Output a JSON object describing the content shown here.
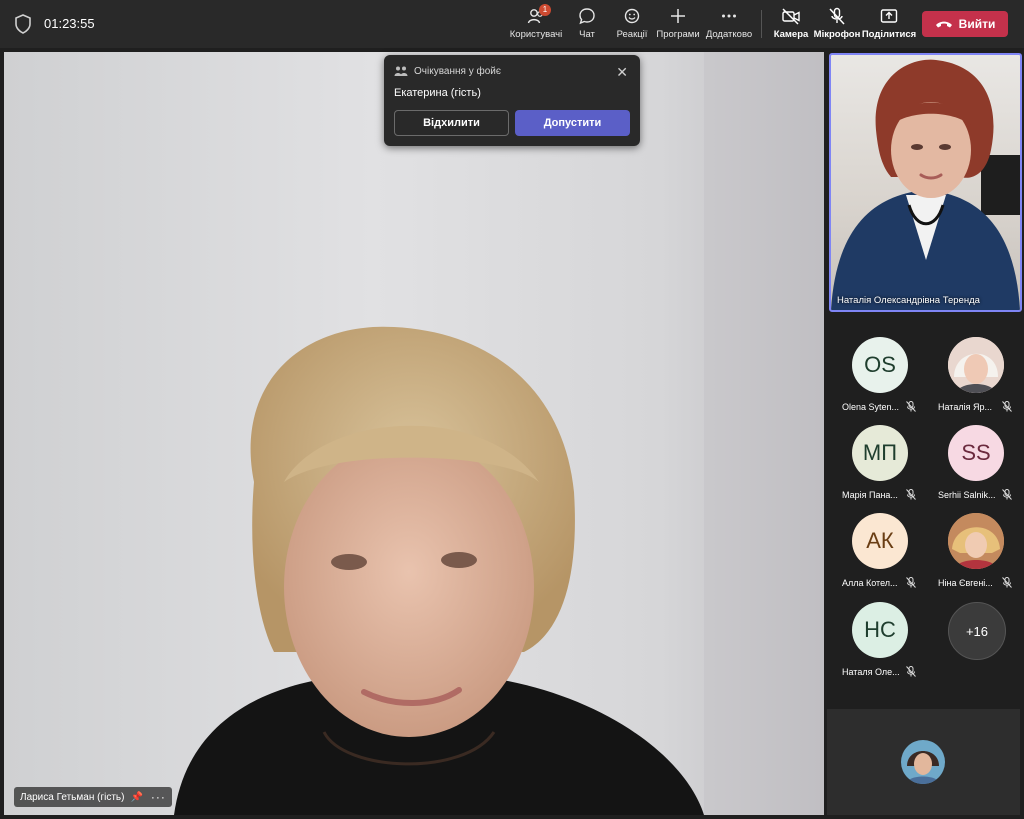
{
  "topbar": {
    "timer": "01:23:55",
    "participants_label": "Користувачі",
    "participants_badge": "1",
    "chat_label": "Чат",
    "reactions_label": "Реакції",
    "apps_label": "Програми",
    "more_label": "Додатково",
    "camera_label": "Камера",
    "mic_label": "Мікрофон",
    "share_label": "Поділитися",
    "leave_label": "Вийти",
    "leave_color": "#c4314b"
  },
  "lobby": {
    "title": "Очікування у фойє",
    "guest_name": "Екатерина (гість)",
    "deny_label": "Відхилити",
    "admit_label": "Допустити",
    "admit_color": "#5b5fc7"
  },
  "main_video": {
    "name": "Лариса Гетьман (гість)"
  },
  "speaker": {
    "name": "Наталія Олександрівна Теренда",
    "border_color": "#7f85f5"
  },
  "gallery": {
    "tiles": [
      {
        "initials": "OS",
        "name": "Olena Syten...",
        "color": "#e8f2ec"
      },
      {
        "initials": "",
        "name": "Наталія Яр...",
        "color": "#e9d7cf"
      },
      {
        "initials": "МП",
        "name": "Марія Пана...",
        "color": "#e6ead8"
      },
      {
        "initials": "SS",
        "name": "Serhii Salnik...",
        "color": "#f7d9e3"
      },
      {
        "initials": "АК",
        "name": "Алла Котел...",
        "color": "#fbe7d2"
      },
      {
        "initials": "",
        "name": "Ніна Євгені...",
        "color": "#d9a57a"
      },
      {
        "initials": "НС",
        "name": "Наталя Оле...",
        "color": "#dcefe4"
      }
    ],
    "overflow_count": "+16"
  }
}
